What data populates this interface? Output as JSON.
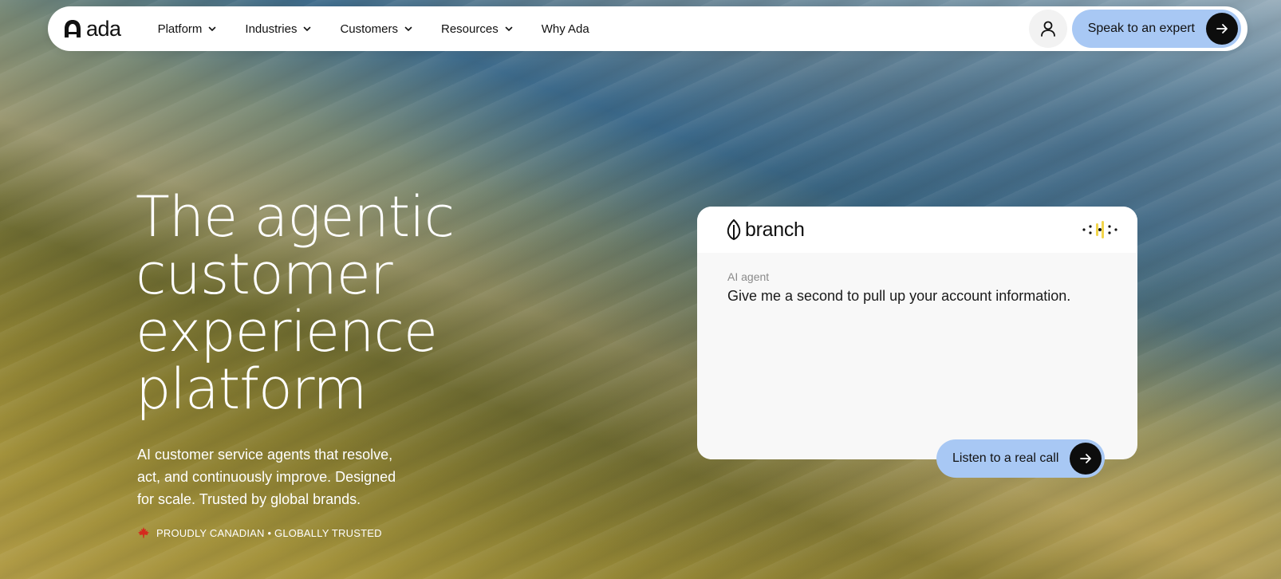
{
  "nav": {
    "logo_text": "ada",
    "items": [
      {
        "label": "Platform",
        "has_dropdown": true
      },
      {
        "label": "Industries",
        "has_dropdown": true
      },
      {
        "label": "Customers",
        "has_dropdown": true
      },
      {
        "label": "Resources",
        "has_dropdown": true
      },
      {
        "label": "Why Ada",
        "has_dropdown": false
      }
    ],
    "cta_label": "Speak to an expert",
    "user_icon": "user-icon"
  },
  "hero": {
    "title": "The agentic customer experience platform",
    "subtitle": "AI customer service agents that resolve, act, and continuously improve. Designed for scale. Trusted by global brands.",
    "badge": "PROUDLY CANADIAN • GLOBALLY TRUSTED",
    "badge_icon": "maple-leaf-icon"
  },
  "card": {
    "brand_name": "branch",
    "agent_label": "AI agent",
    "message": "Give me a second to pull up your account information.",
    "call_button_label": "Listen to a real call"
  },
  "colors": {
    "cta_bg": "#a8c8f4",
    "arrow_bg": "#0d0d0d",
    "nav_bg": "#ffffff",
    "maple_red": "#d52b1e",
    "voice_yellow": "#f2d54a"
  }
}
